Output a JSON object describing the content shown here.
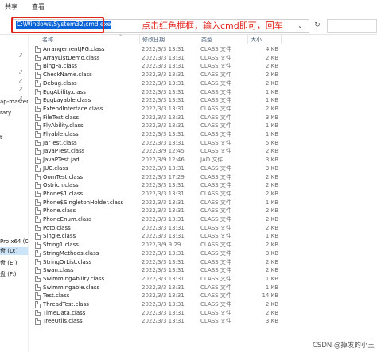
{
  "ribbon": {
    "tabs": [
      "共享",
      "查看"
    ]
  },
  "address": {
    "path": "C:\\Windows\\System32\\cmd.exe",
    "annotation": "点击红色框框，输入cmd即可，回车",
    "dropdown_icon": "chevron-down-icon",
    "refresh_icon": "refresh-icon"
  },
  "nav": {
    "items": [
      {
        "label": "",
        "pinned": true
      },
      {
        "label": "",
        "pinned": true
      },
      {
        "label": "",
        "pinned": true
      },
      {
        "label": "",
        "pinned": true
      },
      {
        "label": "",
        "pinned": true
      },
      {
        "label": "ap-master",
        "pinned": false
      },
      {
        "label": "rary",
        "pinned": false
      },
      {
        "label": "t",
        "pinned": false
      },
      {
        "label": "Pro x64 (C",
        "pinned": false
      },
      {
        "label": "盘 (D:)",
        "pinned": false
      },
      {
        "label": "盘 (E:)",
        "pinned": false
      },
      {
        "label": "盘 (F:)",
        "pinned": false
      }
    ]
  },
  "columns": {
    "name": "名称",
    "modified": "修改日期",
    "type": "类型",
    "size": "大小"
  },
  "files": [
    {
      "name": "ArrangementJPG.class",
      "date": "2022/3/3 13:31",
      "type": "CLASS 文件",
      "size": "4 KB"
    },
    {
      "name": "ArrayListDemo.class",
      "date": "2022/3/3 13:31",
      "type": "CLASS 文件",
      "size": "2 KB"
    },
    {
      "name": "BingFa.class",
      "date": "2022/3/3 13:31",
      "type": "CLASS 文件",
      "size": "2 KB"
    },
    {
      "name": "CheckName.class",
      "date": "2022/3/3 13:31",
      "type": "CLASS 文件",
      "size": "2 KB"
    },
    {
      "name": "Debug.class",
      "date": "2022/3/3 13:31",
      "type": "CLASS 文件",
      "size": "2 KB"
    },
    {
      "name": "EggAbility.class",
      "date": "2022/3/3 13:31",
      "type": "CLASS 文件",
      "size": "1 KB"
    },
    {
      "name": "EggLayable.class",
      "date": "2022/3/3 13:31",
      "type": "CLASS 文件",
      "size": "1 KB"
    },
    {
      "name": "ExtendInterface.class",
      "date": "2022/3/3 13:31",
      "type": "CLASS 文件",
      "size": "2 KB"
    },
    {
      "name": "FileTest.class",
      "date": "2022/3/3 13:31",
      "type": "CLASS 文件",
      "size": "3 KB"
    },
    {
      "name": "FlyAbility.class",
      "date": "2022/3/3 13:31",
      "type": "CLASS 文件",
      "size": "1 KB"
    },
    {
      "name": "Flyable.class",
      "date": "2022/3/3 13:31",
      "type": "CLASS 文件",
      "size": "1 KB"
    },
    {
      "name": "JarTest.class",
      "date": "2022/3/3 13:31",
      "type": "CLASS 文件",
      "size": "5 KB"
    },
    {
      "name": "JavaPTest.class",
      "date": "2022/3/9 12:45",
      "type": "CLASS 文件",
      "size": "2 KB"
    },
    {
      "name": "JavaPTest.jad",
      "date": "2022/3/9 12:46",
      "type": "JAD 文件",
      "size": "3 KB"
    },
    {
      "name": "JUC.class",
      "date": "2022/3/3 13:31",
      "type": "CLASS 文件",
      "size": "3 KB"
    },
    {
      "name": "OomTest.class",
      "date": "2022/3/3 17:29",
      "type": "CLASS 文件",
      "size": "2 KB"
    },
    {
      "name": "Ostrich.class",
      "date": "2022/3/3 13:31",
      "type": "CLASS 文件",
      "size": "2 KB"
    },
    {
      "name": "Phone$1.class",
      "date": "2022/3/3 13:31",
      "type": "CLASS 文件",
      "size": "2 KB"
    },
    {
      "name": "Phone$SingletonHolder.class",
      "date": "2022/3/3 13:31",
      "type": "CLASS 文件",
      "size": "1 KB"
    },
    {
      "name": "Phone.class",
      "date": "2022/3/3 13:31",
      "type": "CLASS 文件",
      "size": "2 KB"
    },
    {
      "name": "PhoneEnum.class",
      "date": "2022/3/3 13:31",
      "type": "CLASS 文件",
      "size": "2 KB"
    },
    {
      "name": "Poto.class",
      "date": "2022/3/3 13:31",
      "type": "CLASS 文件",
      "size": "2 KB"
    },
    {
      "name": "Single.class",
      "date": "2022/3/3 13:31",
      "type": "CLASS 文件",
      "size": "1 KB"
    },
    {
      "name": "String1.class",
      "date": "2022/3/9 9:29",
      "type": "CLASS 文件",
      "size": "2 KB"
    },
    {
      "name": "StringMethods.class",
      "date": "2022/3/3 13:31",
      "type": "CLASS 文件",
      "size": "3 KB"
    },
    {
      "name": "StringOrList.class",
      "date": "2022/3/3 13:31",
      "type": "CLASS 文件",
      "size": "2 KB"
    },
    {
      "name": "Swan.class",
      "date": "2022/3/3 13:31",
      "type": "CLASS 文件",
      "size": "2 KB"
    },
    {
      "name": "SwimmingAbility.class",
      "date": "2022/3/3 13:31",
      "type": "CLASS 文件",
      "size": "1 KB"
    },
    {
      "name": "Swimmingable.class",
      "date": "2022/3/3 13:31",
      "type": "CLASS 文件",
      "size": "1 KB"
    },
    {
      "name": "Test.class",
      "date": "2022/3/3 13:31",
      "type": "CLASS 文件",
      "size": "14 KB"
    },
    {
      "name": "ThreadTest.class",
      "date": "2022/3/3 13:31",
      "type": "CLASS 文件",
      "size": "2 KB"
    },
    {
      "name": "TimeData.class",
      "date": "2022/3/3 13:31",
      "type": "CLASS 文件",
      "size": "2 KB"
    },
    {
      "name": "TreeUtils.class",
      "date": "2022/3/3 13:31",
      "type": "CLASS 文件",
      "size": "3 KB"
    }
  ],
  "watermark": "CSDN @掉发的小王",
  "colors": {
    "highlight_border": "#e2231a",
    "selection": "#0a64d8",
    "annotation": "#e2231a"
  }
}
